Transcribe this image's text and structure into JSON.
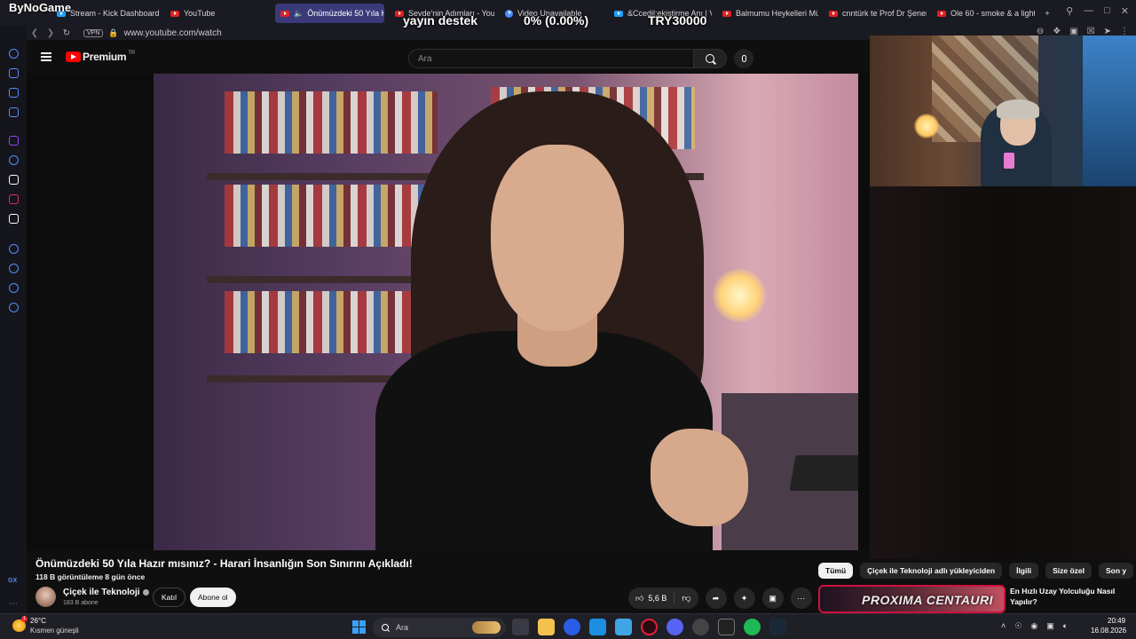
{
  "stream_overlay": {
    "logo": "ByNoGame",
    "goal_label": "yayın destek",
    "goal_progress": "0% (0.00%)",
    "goal_amount": "TRY30000"
  },
  "browser": {
    "tabs": [
      {
        "title": "Stream - Kick Dashboard",
        "active": false,
        "icon": "kick-icon"
      },
      {
        "title": "YouTube",
        "active": false,
        "icon": "youtube-icon"
      },
      {
        "title": "Önümüzdeki 50 Yıla Ha",
        "active": true,
        "icon": "youtube-icon"
      },
      {
        "title": "Sevde'nin Adımları - YouT",
        "active": false,
        "icon": "youtube-icon"
      },
      {
        "title": "Video Unavailable",
        "active": false,
        "icon": "globe-icon"
      },
      {
        "title": "&Ccedil;ekiştirme Anı | Vi",
        "active": false,
        "icon": "vimeo-icon"
      },
      {
        "title": "Balmumu Heykelleri Müze",
        "active": false,
        "icon": "youtube-icon"
      },
      {
        "title": "cnntürk te Prof Dr Şener",
        "active": false,
        "icon": "youtube-icon"
      },
      {
        "title": "Ole 60 - smoke & a light (",
        "active": false,
        "icon": "youtube-icon"
      }
    ],
    "vpn_label": "VPN",
    "url": "www.youtube.com/watch"
  },
  "youtube": {
    "logo_text": "Premium",
    "logo_region": "TR",
    "search_placeholder": "Ara",
    "video": {
      "title": "Önümüzdeki 50 Yıla Hazır mısınız? - Harari İnsanlığın Son Sınırını Açıkladı!",
      "meta": "118 B görüntüleme  8 gün önce",
      "channel_name": "Çiçek ile Teknoloji",
      "subscribers": "183 B abone",
      "join_label": "Katıl",
      "subscribe_label": "Abone ol",
      "like_count": "5,6 B"
    },
    "chips": [
      {
        "label": "Tümü",
        "selected": true
      },
      {
        "label": "Çiçek ile Teknoloji adlı yükleyiciden",
        "selected": false
      },
      {
        "label": "İlgili",
        "selected": false
      },
      {
        "label": "Size özel",
        "selected": false
      },
      {
        "label": "Son y",
        "selected": false
      }
    ],
    "recommendation": {
      "thumbnail_text": "PROXIMA CENTAURI",
      "title": "En Hızlı Uzay Yolculuğu Nasıl Yapılır?"
    }
  },
  "taskbar": {
    "weather_temp": "26°C",
    "weather_desc": "Kısmen güneşli",
    "weather_badge": "1",
    "search_placeholder": "Ara",
    "time": "20:49",
    "date": "16.08.2026"
  },
  "colors": {
    "youtube_red": "#ff0000",
    "active_tab": "#3a3a7a",
    "opera_accent": "#5a8cff",
    "background": "#0f0f0f"
  }
}
